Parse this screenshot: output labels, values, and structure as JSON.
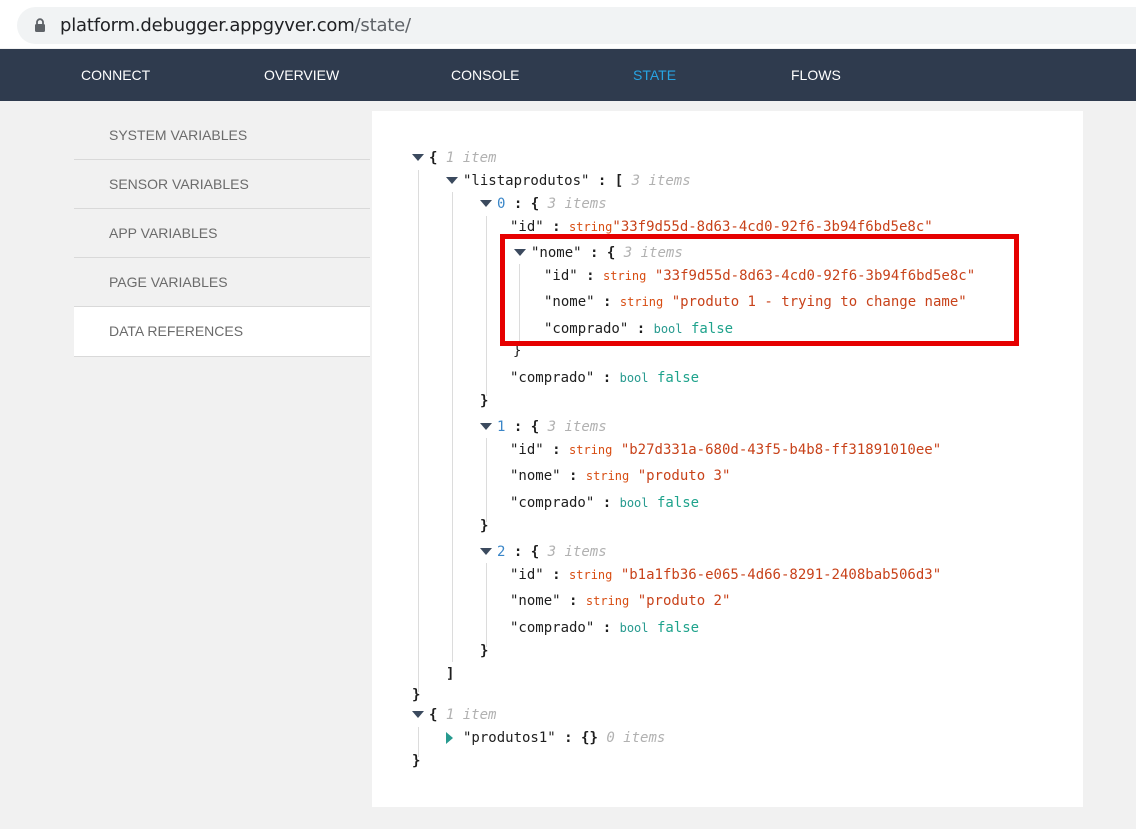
{
  "browser": {
    "url_host": "platform.debugger.appgyver.com",
    "url_path": "/state/"
  },
  "nav": {
    "items": [
      "CONNECT",
      "OVERVIEW",
      "CONSOLE",
      "STATE",
      "FLOWS"
    ],
    "active": "STATE",
    "active_color": "#27a3e2"
  },
  "sidebar": {
    "items": [
      "SYSTEM VARIABLES",
      "SENSOR VARIABLES",
      "APP VARIABLES",
      "PAGE VARIABLES",
      "DATA REFERENCES"
    ],
    "active": "DATA REFERENCES"
  },
  "state": {
    "root1": {
      "open": "{",
      "count": "1 item",
      "close": "}"
    },
    "listaprodutos": {
      "key": "\"listaprodutos\"",
      "open": "[",
      "count": "3 items",
      "close": "]"
    },
    "item0": {
      "index": "0",
      "open": "{",
      "count": "3 items",
      "close": "}",
      "id": {
        "key": "\"id\"",
        "type": "string",
        "value": "\"33f9d55d-8d63-4cd0-92f6-3b94f6bd5e8c\""
      },
      "nome": {
        "key": "\"nome\"",
        "open": "{",
        "count": "3 items",
        "close": "}",
        "id": {
          "key": "\"id\"",
          "type": "string",
          "value": "\"33f9d55d-8d63-4cd0-92f6-3b94f6bd5e8c\""
        },
        "nome": {
          "key": "\"nome\"",
          "type": "string",
          "value": "\"produto 1 - trying to change name\""
        },
        "comprado": {
          "key": "\"comprado\"",
          "type": "bool",
          "value": "false"
        }
      },
      "comprado": {
        "key": "\"comprado\"",
        "type": "bool",
        "value": "false"
      }
    },
    "item1": {
      "index": "1",
      "open": "{",
      "count": "3 items",
      "close": "}",
      "id": {
        "key": "\"id\"",
        "type": "string",
        "value": "\"b27d331a-680d-43f5-b4b8-ff31891010ee\""
      },
      "nome": {
        "key": "\"nome\"",
        "type": "string",
        "value": "\"produto 3\""
      },
      "comprado": {
        "key": "\"comprado\"",
        "type": "bool",
        "value": "false"
      }
    },
    "item2": {
      "index": "2",
      "open": "{",
      "count": "3 items",
      "close": "}",
      "id": {
        "key": "\"id\"",
        "type": "string",
        "value": "\"b1a1fb36-e065-4d66-8291-2408bab506d3\""
      },
      "nome": {
        "key": "\"nome\"",
        "type": "string",
        "value": "\"produto 2\""
      },
      "comprado": {
        "key": "\"comprado\"",
        "type": "bool",
        "value": "false"
      }
    },
    "root2": {
      "open": "{",
      "count": "1 item",
      "close": "}"
    },
    "produtos1": {
      "key": "\"produtos1\"",
      "braces": "{}",
      "count": "0 items"
    }
  },
  "colors": {
    "nav_bg": "#2f3b4e",
    "highlight_border": "#e60000",
    "string_type": "#d84d12",
    "bool_type": "#279a8f"
  }
}
